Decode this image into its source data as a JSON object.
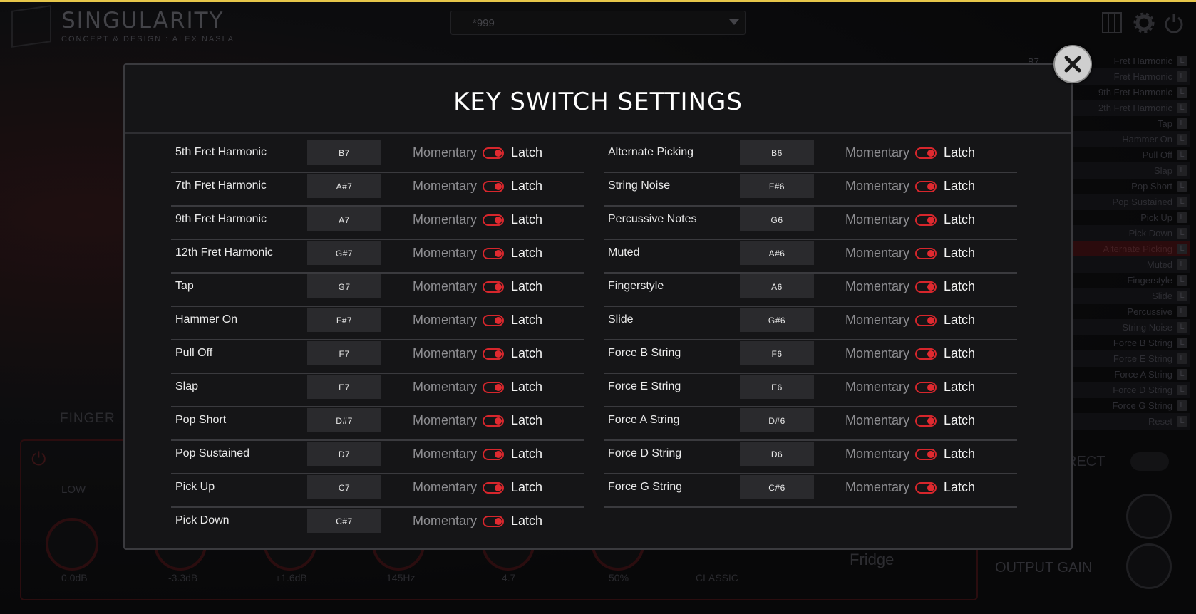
{
  "app": {
    "logo_title": "SINGULARITY",
    "logo_subtitle": "CONCEPT & DESIGN : ALEX NASLA",
    "preset": "*999"
  },
  "background": {
    "side_key": "B7",
    "side_items": [
      "Fret Harmonic",
      "Fret Harmonic",
      "9th Fret Harmonic",
      "2th Fret Harmonic",
      "Tap",
      "Hammer On",
      "Pull Off",
      "Slap",
      "Pop Short",
      "Pop Sustained",
      "Pick Up",
      "Pick Down",
      "Alternate Picking",
      "Muted",
      "Fingerstyle",
      "Slide",
      "Percussive",
      "String Noise",
      "Force B String",
      "Force E String",
      "Force A String",
      "Force D String",
      "Force G String",
      "Reset"
    ],
    "side_key_badge": "L",
    "finger_label": "FINGER",
    "eq_low": "LOW",
    "knob_values": [
      "0.0dB",
      "-3.3dB",
      "+1.6dB",
      "145Hz",
      "4.7",
      "50%",
      "CLASSIC"
    ],
    "fridge": "Fridge",
    "output_gain": "OUTPUT GAIN",
    "rect": "RECT"
  },
  "modal": {
    "title": "KEY SWITCH SETTINGS",
    "momentary_label": "Momentary",
    "latch_label": "Latch",
    "left": [
      {
        "name": "5th Fret Harmonic",
        "key": "B7"
      },
      {
        "name": "7th Fret Harmonic",
        "key": "A#7"
      },
      {
        "name": "9th Fret Harmonic",
        "key": "A7"
      },
      {
        "name": "12th Fret Harmonic",
        "key": "G#7"
      },
      {
        "name": "Tap",
        "key": "G7"
      },
      {
        "name": "Hammer On",
        "key": "F#7"
      },
      {
        "name": "Pull Off",
        "key": "F7"
      },
      {
        "name": "Slap",
        "key": "E7"
      },
      {
        "name": "Pop Short",
        "key": "D#7"
      },
      {
        "name": "Pop Sustained",
        "key": "D7"
      },
      {
        "name": "Pick Up",
        "key": "C7"
      },
      {
        "name": "Pick Down",
        "key": "C#7"
      }
    ],
    "right": [
      {
        "name": "Alternate Picking",
        "key": "B6"
      },
      {
        "name": "String Noise",
        "key": "F#6"
      },
      {
        "name": "Percussive Notes",
        "key": "G6"
      },
      {
        "name": "Muted",
        "key": "A#6"
      },
      {
        "name": "Fingerstyle",
        "key": "A6"
      },
      {
        "name": "Slide",
        "key": "G#6"
      },
      {
        "name": "Force B String",
        "key": "F6"
      },
      {
        "name": "Force E String",
        "key": "E6"
      },
      {
        "name": "Force A String",
        "key": "D#6"
      },
      {
        "name": "Force D String",
        "key": "D6"
      },
      {
        "name": "Force G String",
        "key": "C#6"
      }
    ]
  },
  "colors": {
    "accent": "#e02a30",
    "modal_bg": "#151517",
    "key_bg": "#2a2a2d"
  },
  "icons": {
    "close": "close-icon",
    "settings": "gear-icon",
    "power": "power-icon",
    "keyboard": "piano-icon"
  }
}
